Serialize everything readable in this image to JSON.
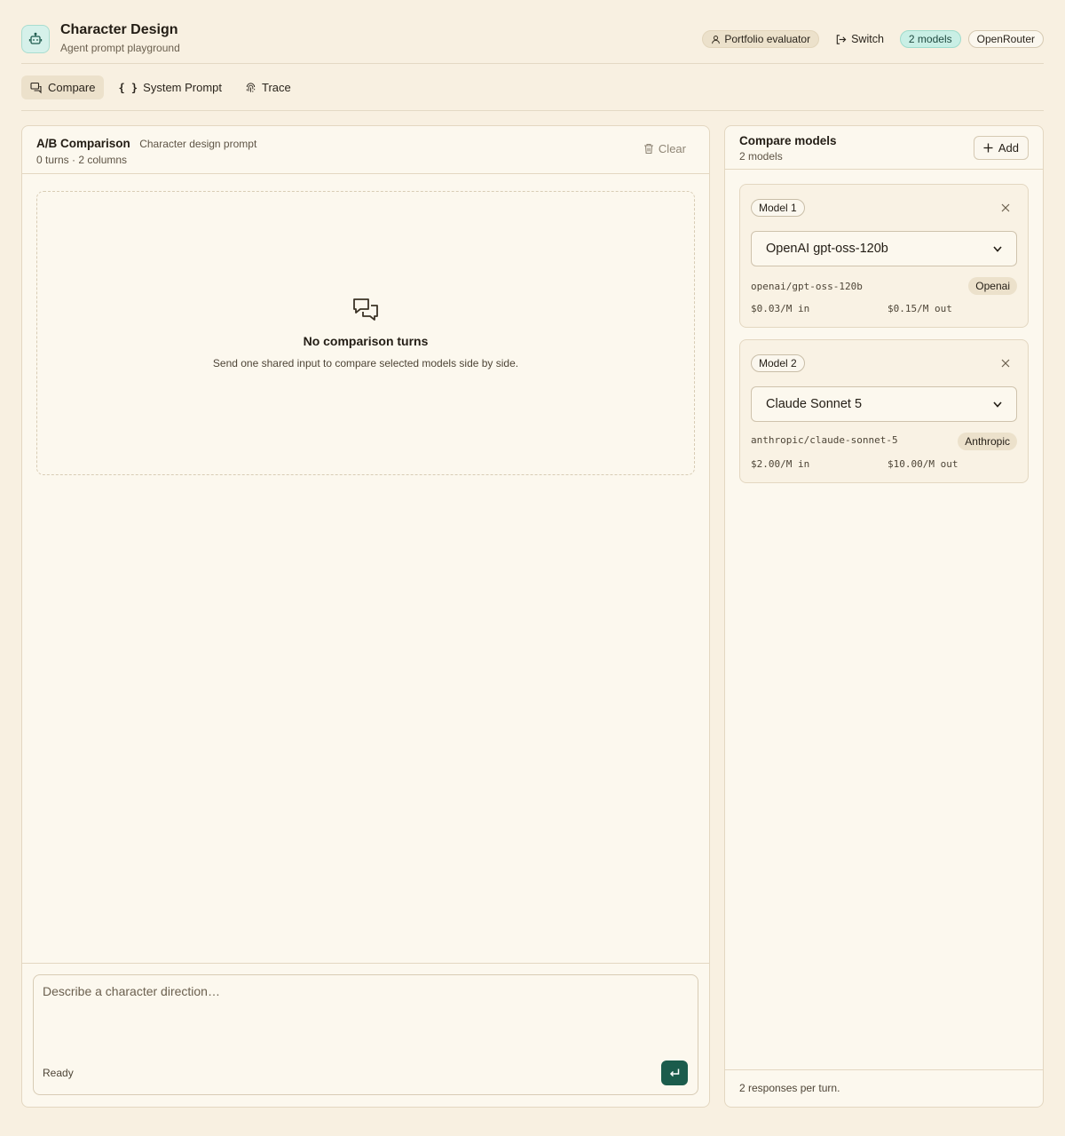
{
  "app": {
    "title": "Character Design",
    "subtitle": "Agent prompt playground",
    "role_label": "Portfolio evaluator",
    "switch_label": "Switch",
    "models_pill": "2 models",
    "provider_pill": "OpenRouter"
  },
  "tabs": [
    {
      "label": "Compare",
      "active": true
    },
    {
      "label": "System Prompt",
      "active": false
    },
    {
      "label": "Trace",
      "active": false
    }
  ],
  "comparison": {
    "title": "A/B Comparison",
    "tag": "Character design prompt",
    "meta": "0 turns · 2 columns",
    "clear_label": "Clear",
    "empty_title": "No comparison turns",
    "empty_desc": "Send one shared input to compare selected models side by side.",
    "composer_placeholder": "Describe a character direction…",
    "status": "Ready"
  },
  "compare_models": {
    "title": "Compare models",
    "count": "2 models",
    "add_label": "Add",
    "models": [
      {
        "badge": "Model 1",
        "selected": "OpenAI gpt-oss-120b",
        "id": "openai/gpt-oss-120b",
        "provider": "Openai",
        "price_in": "$0.03/M in",
        "price_out": "$0.15/M out"
      },
      {
        "badge": "Model 2",
        "selected": "Claude Sonnet 5",
        "id": "anthropic/claude-sonnet-5",
        "provider": "Anthropic",
        "price_in": "$2.00/M in",
        "price_out": "$10.00/M out"
      }
    ],
    "footer": "2 responses per turn."
  },
  "colors": {
    "background": "#f8f0e1",
    "panel": "#fcf8ee",
    "accent": "#1b5c4c",
    "models_pill": "#c9efe5"
  },
  "icons": {
    "brand": "robot-icon",
    "role": "user-icon",
    "switch": "logout-icon",
    "compare_tab": "chat-icon",
    "system_prompt_tab": "braces-icon",
    "trace_tab": "fingerprint-icon",
    "clear": "trash-icon",
    "empty": "chat-bubbles-icon",
    "send": "enter-icon",
    "add": "plus-icon",
    "remove": "close-icon",
    "select": "chevron-down-icon"
  }
}
